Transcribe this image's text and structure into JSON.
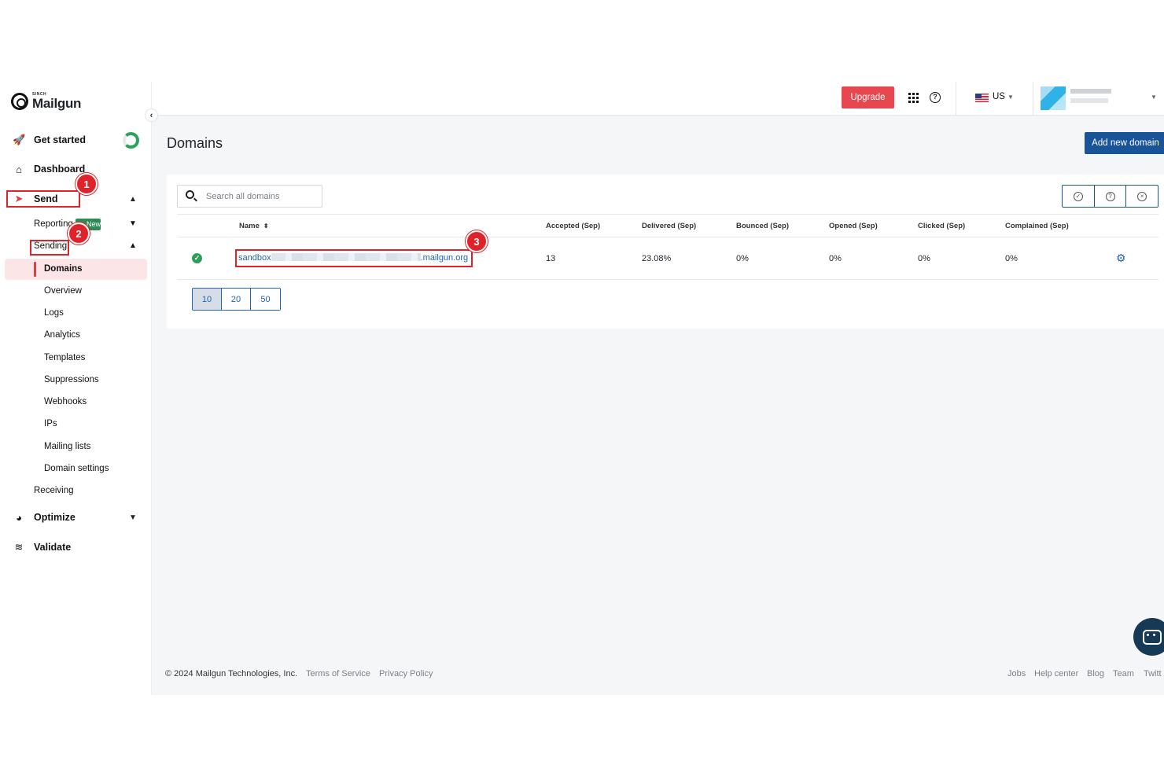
{
  "brand": {
    "sub": "SINCH",
    "name": "Mailgun"
  },
  "sidebar": {
    "get_started": "Get started",
    "dashboard": "Dashboard",
    "send": "Send",
    "reporting": "Reporting",
    "reporting_badge": "New",
    "sending": "Sending",
    "sending_items": [
      "Domains",
      "Overview",
      "Logs",
      "Analytics",
      "Templates",
      "Suppressions",
      "Webhooks",
      "IPs",
      "Mailing lists",
      "Domain settings"
    ],
    "receiving": "Receiving",
    "optimize": "Optimize",
    "validate": "Validate"
  },
  "topbar": {
    "upgrade": "Upgrade",
    "region": "US"
  },
  "page": {
    "title": "Domains",
    "add_button": "Add new domain"
  },
  "search": {
    "placeholder": "Search all domains"
  },
  "table": {
    "columns": [
      "Name",
      "Accepted (Sep)",
      "Delivered (Sep)",
      "Bounced (Sep)",
      "Opened (Sep)",
      "Clicked (Sep)",
      "Complained (Sep)"
    ],
    "rows": [
      {
        "name_prefix": "sandbox",
        "name_suffix": ".mailgun.org",
        "accepted": "13",
        "delivered": "23.08%",
        "bounced": "0%",
        "opened": "0%",
        "clicked": "0%",
        "complained": "0%"
      }
    ]
  },
  "pagination": {
    "sizes": [
      "10",
      "20",
      "50"
    ],
    "selected": "10"
  },
  "annotations": [
    "1",
    "2",
    "3"
  ],
  "footer": {
    "copyright": "© 2024 Mailgun Technologies, Inc.",
    "terms": "Terms of Service",
    "privacy": "Privacy Policy",
    "jobs": "Jobs",
    "help_center": "Help center",
    "blog": "Blog",
    "team": "Team",
    "twitter": "Twitt"
  },
  "colors": {
    "accent_red": "#e7484f",
    "primary_blue": "#195499",
    "link_blue": "#1f64b5",
    "success_green": "#2f9e57",
    "annotation_red": "#e0232a"
  }
}
